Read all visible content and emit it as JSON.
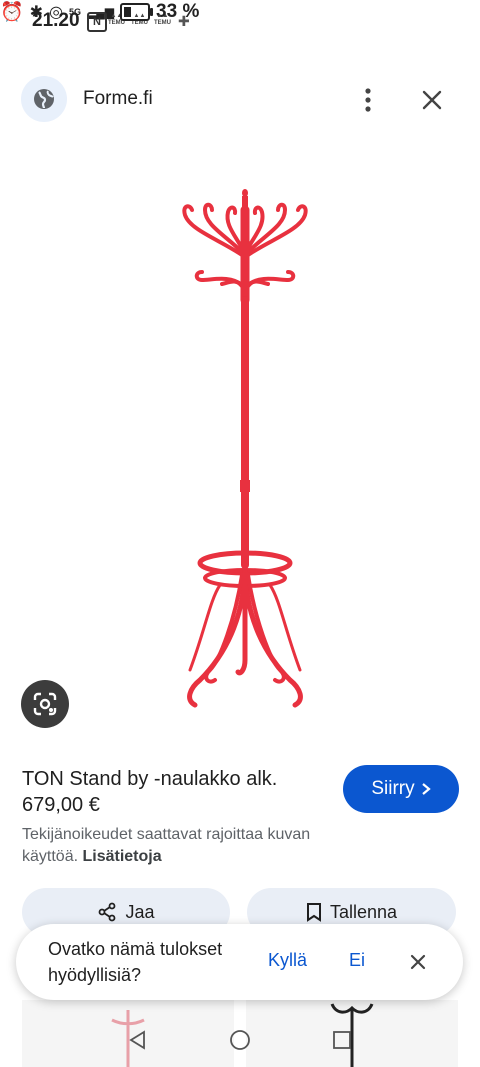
{
  "status_bar": {
    "time": "21.20",
    "nfc": "N",
    "temu_labels": [
      "TEMU",
      "TEMU",
      "TEMU"
    ],
    "network": "5G",
    "battery": "33 %",
    "battery_level": 0.33
  },
  "header": {
    "site_name": "Forme.fi"
  },
  "product": {
    "title": "TON Stand by -naulakko alk.",
    "price": "679,00 €",
    "visit_label": "Siirry",
    "copyright_text": "Tekijänoikeudet saattavat rajoittaa kuvan käyttöä.",
    "more_info_link": "Lisätietoja",
    "image_color": "#e8313f"
  },
  "actions": {
    "share_label": "Jaa",
    "save_label": "Tallenna"
  },
  "feedback": {
    "question": "Ovatko nämä tulokset hyödyllisiä?",
    "yes_label": "Kyllä",
    "no_label": "Ei"
  },
  "colors": {
    "accent": "#0b57d0",
    "pill_bg": "#e9eef6",
    "product_red": "#e8313f"
  }
}
